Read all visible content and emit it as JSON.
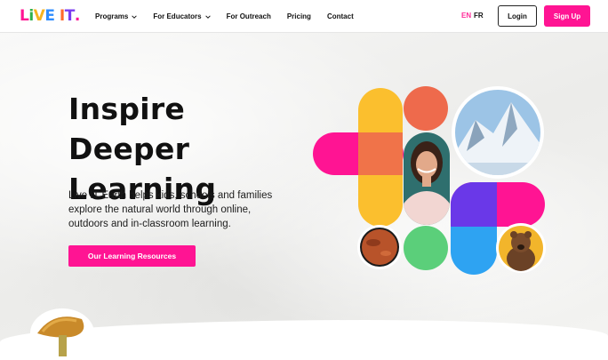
{
  "nav": {
    "logo_letters": [
      {
        "char": "L",
        "color": "#ff1493"
      },
      {
        "char": "i",
        "color": "#2db04b"
      },
      {
        "char": "V",
        "color": "#f5b320"
      },
      {
        "char": "E",
        "color": "#2d8cff"
      },
      {
        "char": " ",
        "color": "#111111"
      },
      {
        "char": "I",
        "color": "#ff6a2d"
      },
      {
        "char": "T",
        "color": "#7a3cf0"
      },
      {
        "char": ".",
        "color": "#ff1493"
      }
    ],
    "items": [
      {
        "label": "Programs",
        "has_dropdown": true
      },
      {
        "label": "For Educators",
        "has_dropdown": true
      },
      {
        "label": "For Outreach",
        "has_dropdown": false
      },
      {
        "label": "Pricing",
        "has_dropdown": false
      },
      {
        "label": "Contact",
        "has_dropdown": false
      }
    ],
    "lang_en": "EN",
    "lang_fr": "FR",
    "login_label": "Login",
    "signup_label": "Sign Up"
  },
  "hero": {
    "title_line1": "Inspire Deeper",
    "title_line2": "Learning",
    "description": "Live IT Earth helps kids, schools and families explore the natural world through online, outdoors and in-classroom learning.",
    "cta_label": "Our Learning Resources"
  },
  "colors": {
    "accent": "#ff1493",
    "yellow": "#fbbf2e",
    "coral": "#ee6a4c",
    "green": "#5bcf7a",
    "blue": "#2ea3f2",
    "purple": "#6a38e8"
  },
  "collage_images": [
    "girl-portrait",
    "snowy-mountain",
    "mars-planet",
    "grizzly-bear",
    "mushroom"
  ]
}
